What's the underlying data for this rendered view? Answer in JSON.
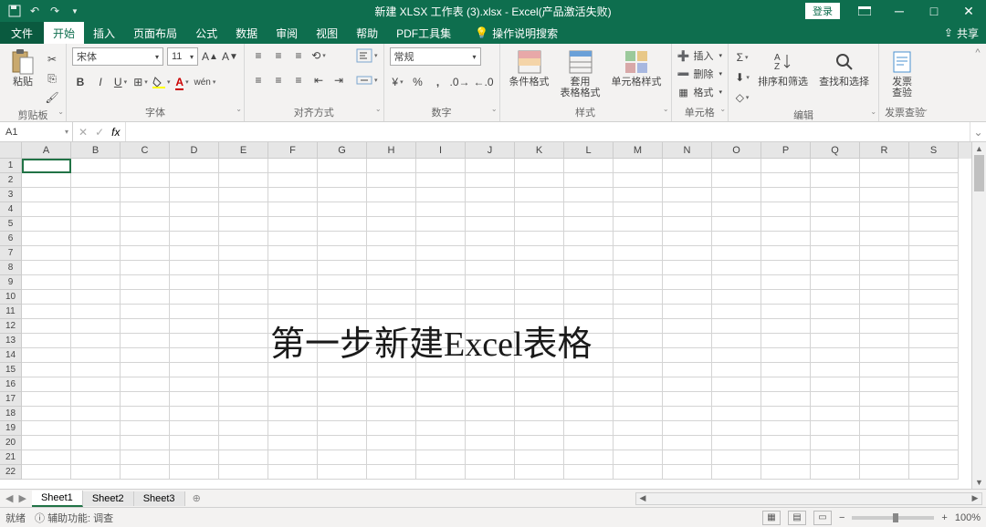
{
  "title": "新建 XLSX 工作表 (3).xlsx - Excel(产品激活失败)",
  "qat": {
    "login": "登录"
  },
  "tabs": {
    "file": "文件",
    "items": [
      "开始",
      "插入",
      "页面布局",
      "公式",
      "数据",
      "审阅",
      "视图",
      "帮助",
      "PDF工具集"
    ],
    "active": "开始",
    "tellme": "操作说明搜索",
    "share": "共享"
  },
  "ribbon": {
    "clipboard": {
      "paste": "粘贴",
      "label": "剪贴板"
    },
    "font": {
      "name": "宋体",
      "size": "11",
      "label": "字体"
    },
    "align": {
      "label": "对齐方式"
    },
    "number": {
      "format": "常规",
      "label": "数字"
    },
    "styles": {
      "cond": "条件格式",
      "table": "套用\n表格格式",
      "cell": "单元格样式",
      "label": "样式"
    },
    "cells": {
      "insert": "插入",
      "delete": "删除",
      "format": "格式",
      "label": "单元格"
    },
    "editing": {
      "sort": "排序和筛选",
      "find": "查找和选择",
      "label": "编辑"
    },
    "invoice": {
      "check": "发票\n查验",
      "label": "发票查验"
    }
  },
  "formula_bar": {
    "namebox": "A1",
    "fx": "fx"
  },
  "grid": {
    "columns": [
      "A",
      "B",
      "C",
      "D",
      "E",
      "F",
      "G",
      "H",
      "I",
      "J",
      "K",
      "L",
      "M",
      "N",
      "O",
      "P",
      "Q",
      "R",
      "S"
    ],
    "rows": 22,
    "selected": "A1"
  },
  "overlay": "第一步新建Excel表格",
  "sheets": {
    "tabs": [
      "Sheet1",
      "Sheet2",
      "Sheet3"
    ],
    "active": "Sheet1",
    "add": "⊕"
  },
  "status": {
    "ready": "就绪",
    "access": "辅助功能: 调查",
    "zoom": "100%"
  }
}
